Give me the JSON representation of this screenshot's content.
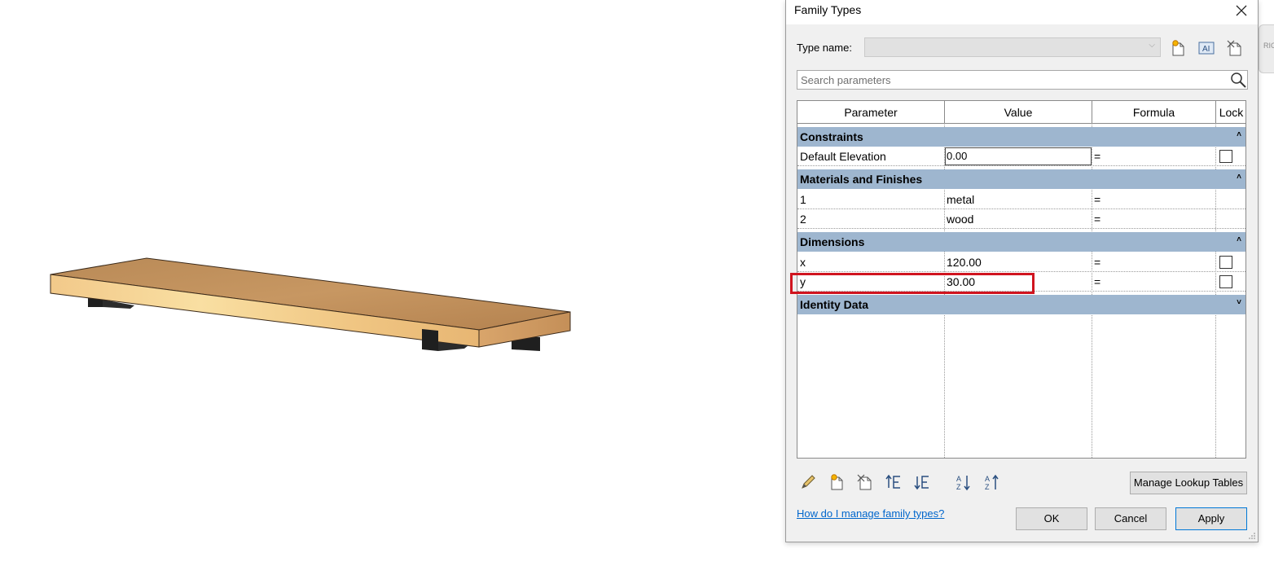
{
  "dialog": {
    "title": "Family Types",
    "type_name_label": "Type name:",
    "type_name_value": "",
    "search_placeholder": "Search parameters",
    "columns": [
      "Parameter",
      "Value",
      "Formula",
      "Lock"
    ],
    "groups": {
      "constraints": "Constraints",
      "materials": "Materials and Finishes",
      "dimensions": "Dimensions",
      "identity": "Identity Data"
    },
    "rows": {
      "default_elevation": {
        "param": "Default Elevation",
        "value": "0.00",
        "formula": "="
      },
      "material_1": {
        "param": "1",
        "value": "metal",
        "formula": "="
      },
      "material_2": {
        "param": "2",
        "value": "wood",
        "formula": "="
      },
      "dim_x": {
        "param": "x",
        "value": "120.00",
        "formula": "="
      },
      "dim_y": {
        "param": "y",
        "value": "30.00",
        "formula": "="
      }
    },
    "manage_lookup_label": "Manage Lookup Tables",
    "help_link": "How do I manage family types?",
    "ok_label": "OK",
    "cancel_label": "Cancel",
    "apply_label": "Apply"
  },
  "viewcube_label": "RIG",
  "colors": {
    "group_header": "#9eb6cf",
    "highlight": "#d0141f",
    "link": "#0066cc"
  }
}
